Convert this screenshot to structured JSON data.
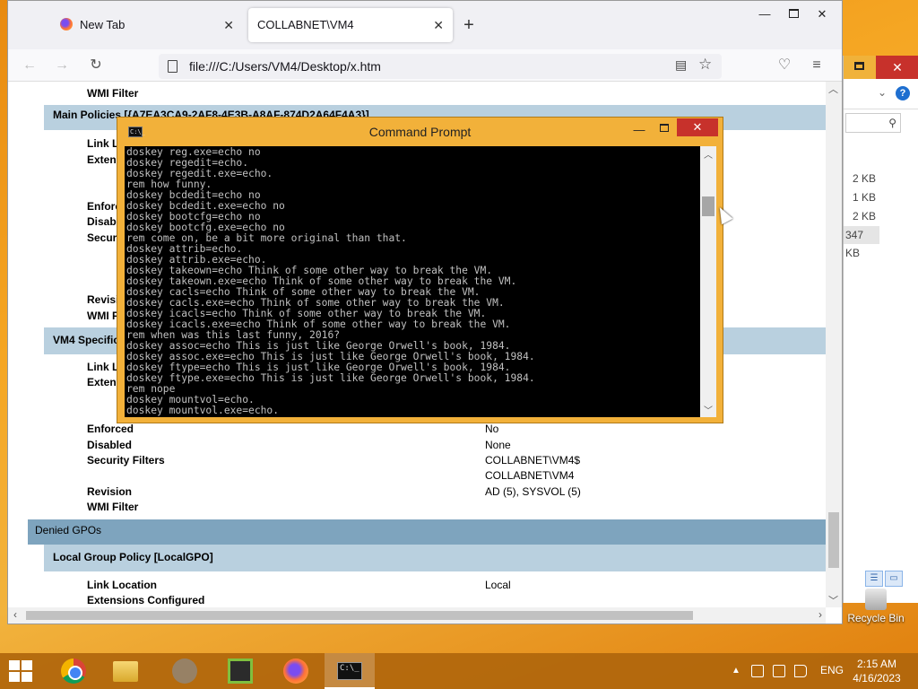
{
  "firefox": {
    "tabs": [
      {
        "label": "New Tab"
      },
      {
        "label": "COLLABNET\\VM4"
      }
    ],
    "new_tab_symbol": "+",
    "url": "file:///C:/Users/VM4/Desktop/x.htm",
    "icons": {
      "back": "arrow-left-icon",
      "forward": "arrow-right-icon",
      "reload": "reload-icon",
      "reader": "reader-view-icon",
      "bookmark": "star-icon",
      "pocket": "pocket-icon",
      "menu": "hamburger-menu-icon"
    }
  },
  "report": {
    "wmi_filter_top": "WMI Filter",
    "main_policies_header": "Main Policies [{A7EA3CA9-2AF8-4E3B-A8AF-874D2A64F4A3}]",
    "partial_labels": [
      "Link L",
      "Extens",
      "Enforc",
      "Disabl",
      "Securi",
      "Revisi",
      "WMI F"
    ],
    "vm4_specific_header": "VM4 Specific",
    "partial_labels_2": [
      "Link L",
      "Extens"
    ],
    "rows": [
      {
        "label": "Enforced",
        "value": "No"
      },
      {
        "label": "Disabled",
        "value": "None"
      },
      {
        "label": "Security Filters",
        "value": "COLLABNET\\VM4$"
      },
      {
        "label": "",
        "value": "COLLABNET\\VM4"
      },
      {
        "label": "Revision",
        "value": "AD (5), SYSVOL (5)"
      },
      {
        "label": "WMI Filter",
        "value": ""
      }
    ],
    "denied_gpos_header": "Denied GPOs",
    "local_gp_header": "Local Group Policy [LocalGPO]",
    "local_rows": [
      {
        "label": "Link Location",
        "value": "Local"
      },
      {
        "label": "Extensions Configured",
        "value": ""
      }
    ]
  },
  "cmd": {
    "title": "Command Prompt",
    "lines": [
      "doskey reg.exe=echo no",
      "doskey regedit=echo.",
      "doskey regedit.exe=echo.",
      "rem how funny.",
      "doskey bcdedit=echo no",
      "doskey bcdedit.exe=echo no",
      "doskey bootcfg=echo no",
      "doskey bootcfg.exe=echo no",
      "rem come on, be a bit more original than that.",
      "doskey attrib=echo.",
      "doskey attrib.exe=echo.",
      "doskey takeown=echo Think of some other way to break the VM.",
      "doskey takeown.exe=echo Think of some other way to break the VM.",
      "doskey cacls=echo Think of some other way to break the VM.",
      "doskey cacls.exe=echo Think of some other way to break the VM.",
      "doskey icacls=echo Think of some other way to break the VM.",
      "doskey icacls.exe=echo Think of some other way to break the VM.",
      "rem when was this last funny, 2016?",
      "doskey assoc=echo This is just like George Orwell's book, 1984.",
      "doskey assoc.exe=echo This is just like George Orwell's book, 1984.",
      "doskey ftype=echo This is just like George Orwell's book, 1984.",
      "doskey ftype.exe=echo This is just like George Orwell's book, 1984.",
      "rem nope",
      "doskey mountvol=echo.",
      "doskey mountvol.exe=echo."
    ],
    "icon_text": "C:\\_"
  },
  "explorer": {
    "sizes": [
      "2 KB",
      "1 KB",
      "2 KB",
      "347 KB"
    ]
  },
  "desktop": {
    "recycle_bin": "Recycle Bin"
  },
  "taskbar": {
    "tray_arrow": "▲",
    "language": "ENG",
    "time": "2:15 AM",
    "date": "4/16/2023"
  },
  "colors": {
    "desktop_accent": "#f2b13a",
    "section_header": "#b9d0df",
    "section_header_dark": "#7ea4be",
    "close_red": "#c7312b"
  }
}
